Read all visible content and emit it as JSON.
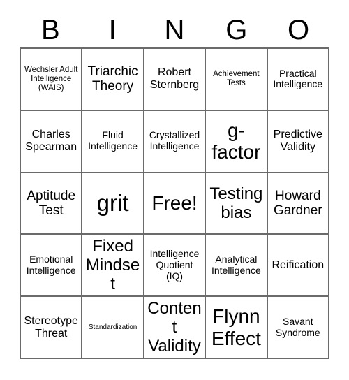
{
  "card": {
    "title_letters": [
      "B",
      "I",
      "N",
      "G",
      "O"
    ],
    "border_color": "#6b6b6b",
    "text_color": "#000000",
    "background_color": "#ffffff",
    "columns": 5,
    "rows": 5,
    "cells": [
      {
        "text": "Wechsler Adult Intelligence (WAIS)",
        "size": "fs-sm"
      },
      {
        "text": "Triarchic Theory",
        "size": "fs-xl"
      },
      {
        "text": "Robert Sternberg",
        "size": "fs-lg"
      },
      {
        "text": "Achievement Tests",
        "size": "fs-sm"
      },
      {
        "text": "Practical Intelligence",
        "size": "fs-md"
      },
      {
        "text": "Charles Spearman",
        "size": "fs-lg"
      },
      {
        "text": "Fluid Intelligence",
        "size": "fs-md"
      },
      {
        "text": "Crystallized Intelligence",
        "size": "fs-md"
      },
      {
        "text": "g-factor",
        "size": "fs-3xl"
      },
      {
        "text": "Predictive Validity",
        "size": "fs-lg"
      },
      {
        "text": "Aptitude Test",
        "size": "fs-xl"
      },
      {
        "text": "grit",
        "size": "fs-4xl"
      },
      {
        "text": "Free!",
        "size": "fs-3xl"
      },
      {
        "text": "Testing bias",
        "size": "fs-2xl"
      },
      {
        "text": "Howard Gardner",
        "size": "fs-xl"
      },
      {
        "text": "Emotional Intelligence",
        "size": "fs-md"
      },
      {
        "text": "Fixed Mindset",
        "size": "fs-2xl"
      },
      {
        "text": "Intelligence Quotient (IQ)",
        "size": "fs-md"
      },
      {
        "text": "Analytical Intelligence",
        "size": "fs-md"
      },
      {
        "text": "Reification",
        "size": "fs-lg"
      },
      {
        "text": "Stereotype Threat",
        "size": "fs-lg"
      },
      {
        "text": "Standardization",
        "size": "fs-xs"
      },
      {
        "text": "Content Validity",
        "size": "fs-2xl"
      },
      {
        "text": "Flynn Effect",
        "size": "fs-3xl"
      },
      {
        "text": "Savant Syndrome",
        "size": "fs-md"
      }
    ]
  }
}
